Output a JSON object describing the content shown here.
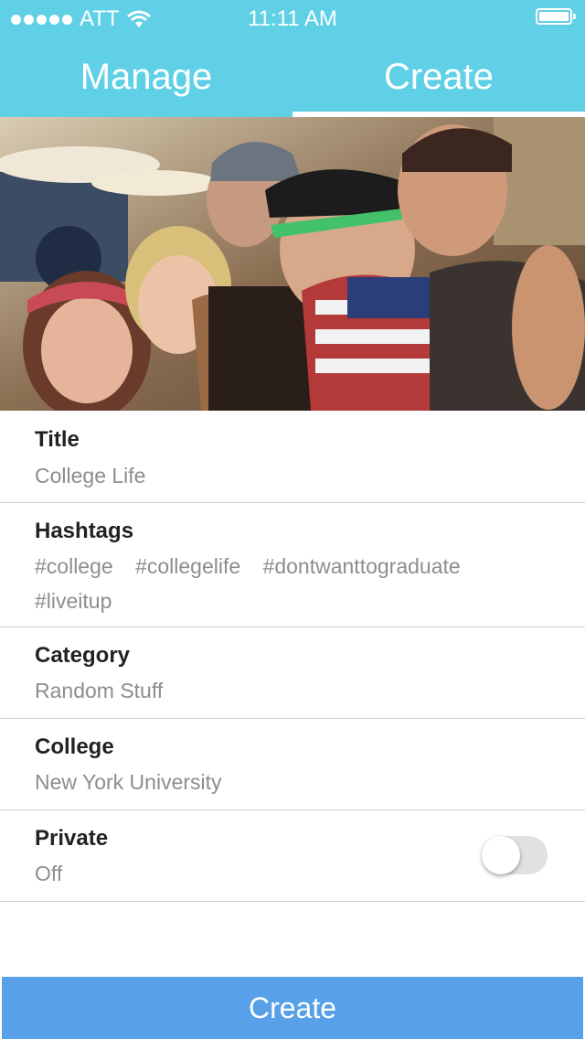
{
  "status_bar": {
    "carrier": "ATT",
    "time": "11:11 AM"
  },
  "tabs": [
    {
      "label": "Manage",
      "active": false
    },
    {
      "label": "Create",
      "active": true
    }
  ],
  "fields": {
    "title": {
      "label": "Title",
      "value": "College Life"
    },
    "hashtags": {
      "label": "Hashtags",
      "tags": [
        "#college",
        "#collegelife",
        "#dontwanttograduate",
        "#liveitup"
      ]
    },
    "category": {
      "label": "Category",
      "value": "Random Stuff"
    },
    "college": {
      "label": "College",
      "value": "New York University"
    },
    "private": {
      "label": "Private",
      "value": "Off",
      "enabled": false
    }
  },
  "create_button": {
    "label": "Create"
  },
  "colors": {
    "header": "#5fd0e6",
    "button": "#58a0e8",
    "label": "#222222",
    "value": "#8d8d8d"
  }
}
